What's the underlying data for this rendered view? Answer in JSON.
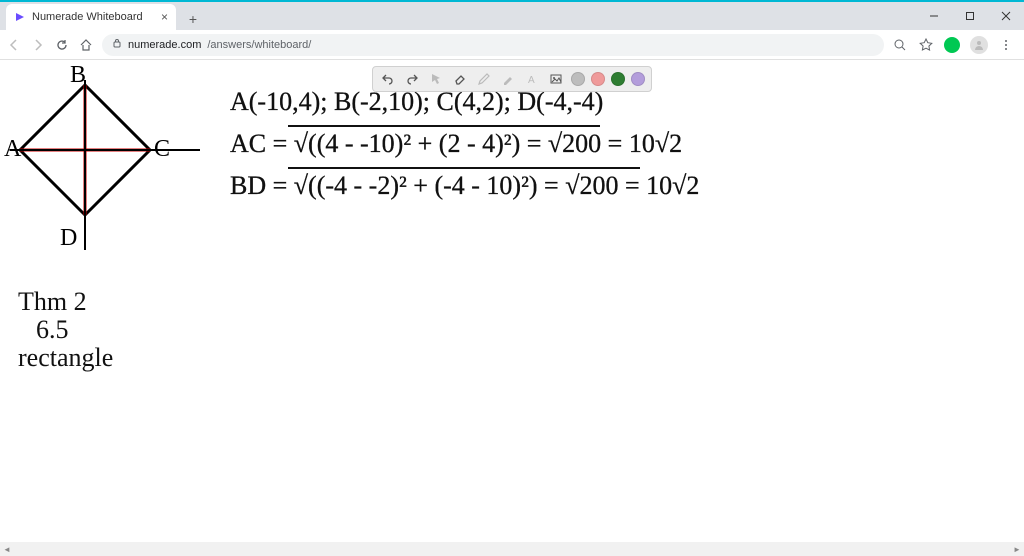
{
  "browser": {
    "tab_title": "Numerade Whiteboard",
    "url_domain": "numerade.com",
    "url_path": "/answers/whiteboard/"
  },
  "toolbar": {
    "tools": [
      "undo",
      "redo",
      "cursor",
      "eraser",
      "pen",
      "highlighter",
      "text",
      "image"
    ],
    "colors": [
      "#bdbdbd",
      "#ef9a9a",
      "#2e7d32",
      "#b39ddb"
    ],
    "selected_color": "#2e7d32"
  },
  "whiteboard": {
    "diagram": {
      "labels": {
        "A": "A",
        "B": "B",
        "C": "C",
        "D": "D"
      }
    },
    "lines": {
      "coords": "A(-10,4); B(-2,10); C(4,2); D(-4,-4)",
      "ac": "AC = √((4 - -10)² + (2 - 4)²)  = √200 = 10√2",
      "bd": "BD = √((-4 - -2)² + (-4 - 10)²) = √200 = 10√2"
    },
    "note": {
      "l1": "Thm 2",
      "l2": "6.5",
      "l3": "rectangle"
    }
  }
}
